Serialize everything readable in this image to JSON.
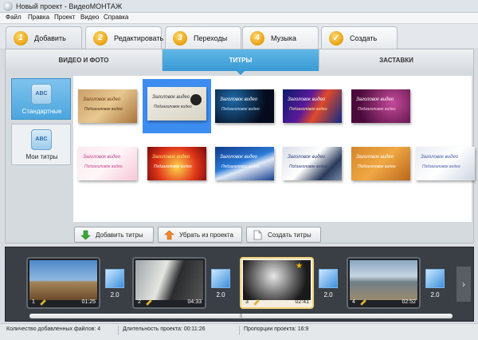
{
  "window": {
    "title": "Новый проект - ВидеоМОНТАЖ"
  },
  "menu": [
    "Файл",
    "Правка",
    "Проект",
    "Видео",
    "Справка"
  ],
  "steps": [
    {
      "num": "1",
      "label": "Добавить"
    },
    {
      "num": "2",
      "label": "Редактировать"
    },
    {
      "num": "3",
      "label": "Переходы"
    },
    {
      "num": "4",
      "label": "Музыка"
    },
    {
      "num": "✓",
      "label": "Создать"
    }
  ],
  "subtabs": [
    "ВИДЕО И ФОТО",
    "ТИТРЫ",
    "ЗАСТАВКИ"
  ],
  "categories": [
    {
      "label": "Стандартные",
      "icon_text": "ABC"
    },
    {
      "label": "Мои титры",
      "icon_text": "ABC"
    }
  ],
  "titles": [
    {
      "line1": "Заголовок видео",
      "line2": "Подзаголовок видео",
      "c1": "#6b3a12",
      "c2": "#4a2a10"
    },
    {
      "line1": "Заголовок видео",
      "line2": "Подзаголовок видео",
      "c1": "#333333",
      "c2": "#333333"
    },
    {
      "line1": "Заголовок видео",
      "line2": "Подзаголовок видео",
      "c1": "#ffffff",
      "c2": "#cfe6ff"
    },
    {
      "line1": "Заголовок видео",
      "line2": "Подзаголовок видео",
      "c1": "#ffffff",
      "c2": "#ffe7a0"
    },
    {
      "line1": "Заголовок видео",
      "line2": "Подзаголовок видео",
      "c1": "#ffffff",
      "c2": "#ffd1ec"
    },
    {
      "line1": "Заголовок видео",
      "line2": "Подзаголовок видео",
      "c1": "#c2418a",
      "c2": "#c2418a"
    },
    {
      "line1": "Заголовок видео",
      "line2": "Подзаголовок видео",
      "c1": "#ffe36a",
      "c2": "#ffffff"
    },
    {
      "line1": "Заголовок видео",
      "line2": "Подзаголовок видео",
      "c1": "#ffffff",
      "c2": "#ffffff"
    },
    {
      "line1": "Заголовок видео",
      "line2": "Подзаголовок видео",
      "c1": "#2f3a7a",
      "c2": "#2f3a7a"
    },
    {
      "line1": "Заголовок видео",
      "line2": "Подзаголовок видео",
      "c1": "#ffffff",
      "c2": "#ffffff"
    },
    {
      "line1": "Заголовок видео",
      "line2": "Подзаголовок видео",
      "c1": "#4a5aa8",
      "c2": "#4a5aa8"
    }
  ],
  "actions": [
    {
      "label": "Добавить титры",
      "icon": "green-down-arrow-icon"
    },
    {
      "label": "Убрать из проекта",
      "icon": "orange-up-arrow-icon"
    },
    {
      "label": "Создать титры",
      "icon": "document-icon"
    }
  ],
  "clips": [
    {
      "num": "1",
      "duration": "01:25"
    },
    {
      "num": "2",
      "duration": "04:33"
    },
    {
      "num": "3",
      "duration": "02:41"
    },
    {
      "num": "4",
      "duration": "02:52"
    }
  ],
  "transitions": [
    "2.0",
    "2.0",
    "2.0",
    "2.0"
  ],
  "status": {
    "files": "Количество добавленных файлов: 4",
    "duration": "Длительность проекта:  00:11:26",
    "ratio": "Пропорции проекта:  16:9"
  },
  "colors": {
    "accent": "#4ba6de",
    "step_badge": "#e7a10f",
    "selection": "#3d8cf0"
  }
}
